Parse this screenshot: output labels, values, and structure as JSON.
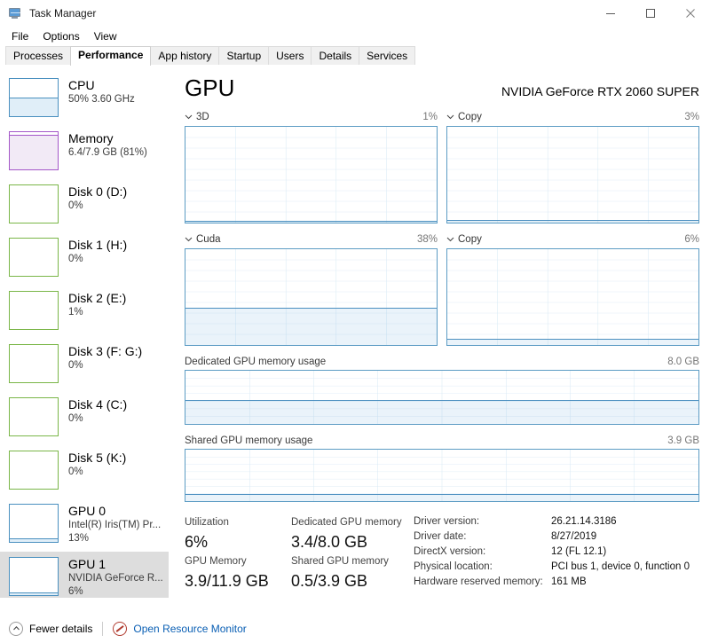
{
  "window": {
    "title": "Task Manager",
    "icon": "task-manager-icon",
    "controls": {
      "minimize": "—",
      "maximize": "☐",
      "close": "✕"
    }
  },
  "menu": {
    "items": [
      "File",
      "Options",
      "View"
    ]
  },
  "tabs": {
    "active": "Performance",
    "items": [
      "Processes",
      "Performance",
      "App history",
      "Startup",
      "Users",
      "Details",
      "Services"
    ]
  },
  "sidebar": {
    "items": [
      {
        "name": "CPU",
        "detail": "50%  3.60 GHz",
        "kind": "cpu",
        "fill_pct": 50,
        "selected": false
      },
      {
        "name": "Memory",
        "detail": "6.4/7.9 GB (81%)",
        "kind": "memory",
        "fill_pct": 81,
        "selected": false
      },
      {
        "name": "Disk 0 (D:)",
        "detail": "0%",
        "kind": "disk",
        "fill_pct": 0,
        "selected": false
      },
      {
        "name": "Disk 1 (H:)",
        "detail": "0%",
        "kind": "disk",
        "fill_pct": 0,
        "selected": false
      },
      {
        "name": "Disk 2 (E:)",
        "detail": "1%",
        "kind": "disk",
        "fill_pct": 1,
        "selected": false
      },
      {
        "name": "Disk 3 (F: G:)",
        "detail": "0%",
        "kind": "disk",
        "fill_pct": 0,
        "selected": false
      },
      {
        "name": "Disk 4 (C:)",
        "detail": "0%",
        "kind": "disk",
        "fill_pct": 0,
        "selected": false
      },
      {
        "name": "Disk 5 (K:)",
        "detail": "0%",
        "kind": "disk",
        "fill_pct": 0,
        "selected": false
      },
      {
        "name": "GPU 0",
        "detail": "Intel(R) Iris(TM) Pr...",
        "detail2": "13%",
        "kind": "gpu",
        "fill_pct": 13,
        "selected": false
      },
      {
        "name": "GPU 1",
        "detail": "NVIDIA GeForce R...",
        "detail2": "6%",
        "kind": "gpu",
        "fill_pct": 6,
        "selected": true
      }
    ]
  },
  "header": {
    "title": "GPU",
    "device": "NVIDIA GeForce RTX 2060 SUPER"
  },
  "chart_data": [
    {
      "type": "area",
      "title": "3D",
      "value_label": "1%",
      "value": 1,
      "ylim": [
        0,
        100
      ],
      "grid": true,
      "xgrid_lines": 5,
      "ygrid_lines": 9
    },
    {
      "type": "area",
      "title": "Copy",
      "value_label": "3%",
      "value": 3,
      "ylim": [
        0,
        100
      ],
      "grid": true,
      "xgrid_lines": 5,
      "ygrid_lines": 9
    },
    {
      "type": "area",
      "title": "Cuda",
      "value_label": "38%",
      "value": 38,
      "ylim": [
        0,
        100
      ],
      "grid": true,
      "xgrid_lines": 5,
      "ygrid_lines": 9
    },
    {
      "type": "area",
      "title": "Copy",
      "value_label": "6%",
      "value": 6,
      "ylim": [
        0,
        100
      ],
      "grid": true,
      "xgrid_lines": 5,
      "ygrid_lines": 9
    },
    {
      "type": "area",
      "title": "Dedicated GPU memory usage",
      "value_label": "8.0 GB",
      "value": 3.4,
      "ylim": [
        0,
        8.0
      ],
      "grid": true,
      "xgrid_lines": 8,
      "ygrid_lines": 7
    },
    {
      "type": "area",
      "title": "Shared GPU memory usage",
      "value_label": "3.9 GB",
      "value": 0.5,
      "ylim": [
        0,
        3.9
      ],
      "grid": true,
      "xgrid_lines": 8,
      "ygrid_lines": 7
    }
  ],
  "graphs": {
    "g1": {
      "label": "3D",
      "value": "1%"
    },
    "g2": {
      "label": "Copy",
      "value": "3%"
    },
    "g3": {
      "label": "Cuda",
      "value": "38%"
    },
    "g4": {
      "label": "Copy",
      "value": "6%"
    },
    "dedicated": {
      "label": "Dedicated GPU memory usage",
      "max": "8.0 GB"
    },
    "shared": {
      "label": "Shared GPU memory usage",
      "max": "3.9 GB"
    }
  },
  "stats": {
    "utilization": {
      "label": "Utilization",
      "value": "6%"
    },
    "gpu_memory": {
      "label": "GPU Memory",
      "value": "3.9/11.9 GB"
    },
    "dedicated_memory": {
      "label": "Dedicated GPU memory",
      "value": "3.4/8.0 GB"
    },
    "shared_memory": {
      "label": "Shared GPU memory",
      "value": "0.5/3.9 GB"
    }
  },
  "info": [
    {
      "key": "Driver version:",
      "value": "26.21.14.3186"
    },
    {
      "key": "Driver date:",
      "value": "8/27/2019"
    },
    {
      "key": "DirectX version:",
      "value": "12 (FL 12.1)"
    },
    {
      "key": "Physical location:",
      "value": "PCI bus 1, device 0, function 0"
    },
    {
      "key": "Hardware reserved memory:",
      "value": "161 MB"
    }
  ],
  "footer": {
    "fewer_details": "Fewer details",
    "resource_monitor": "Open Resource Monitor",
    "chevron_icon": "chevron-up-icon",
    "monitor_icon": "resource-monitor-icon"
  },
  "colors": {
    "gpu_line": "#4b8fc0",
    "cpu_line": "#4a90bf",
    "memory_line": "#a457c8",
    "disk_line": "#7ab648",
    "link": "#0a5fb4",
    "selected_row": "#dddddd"
  }
}
